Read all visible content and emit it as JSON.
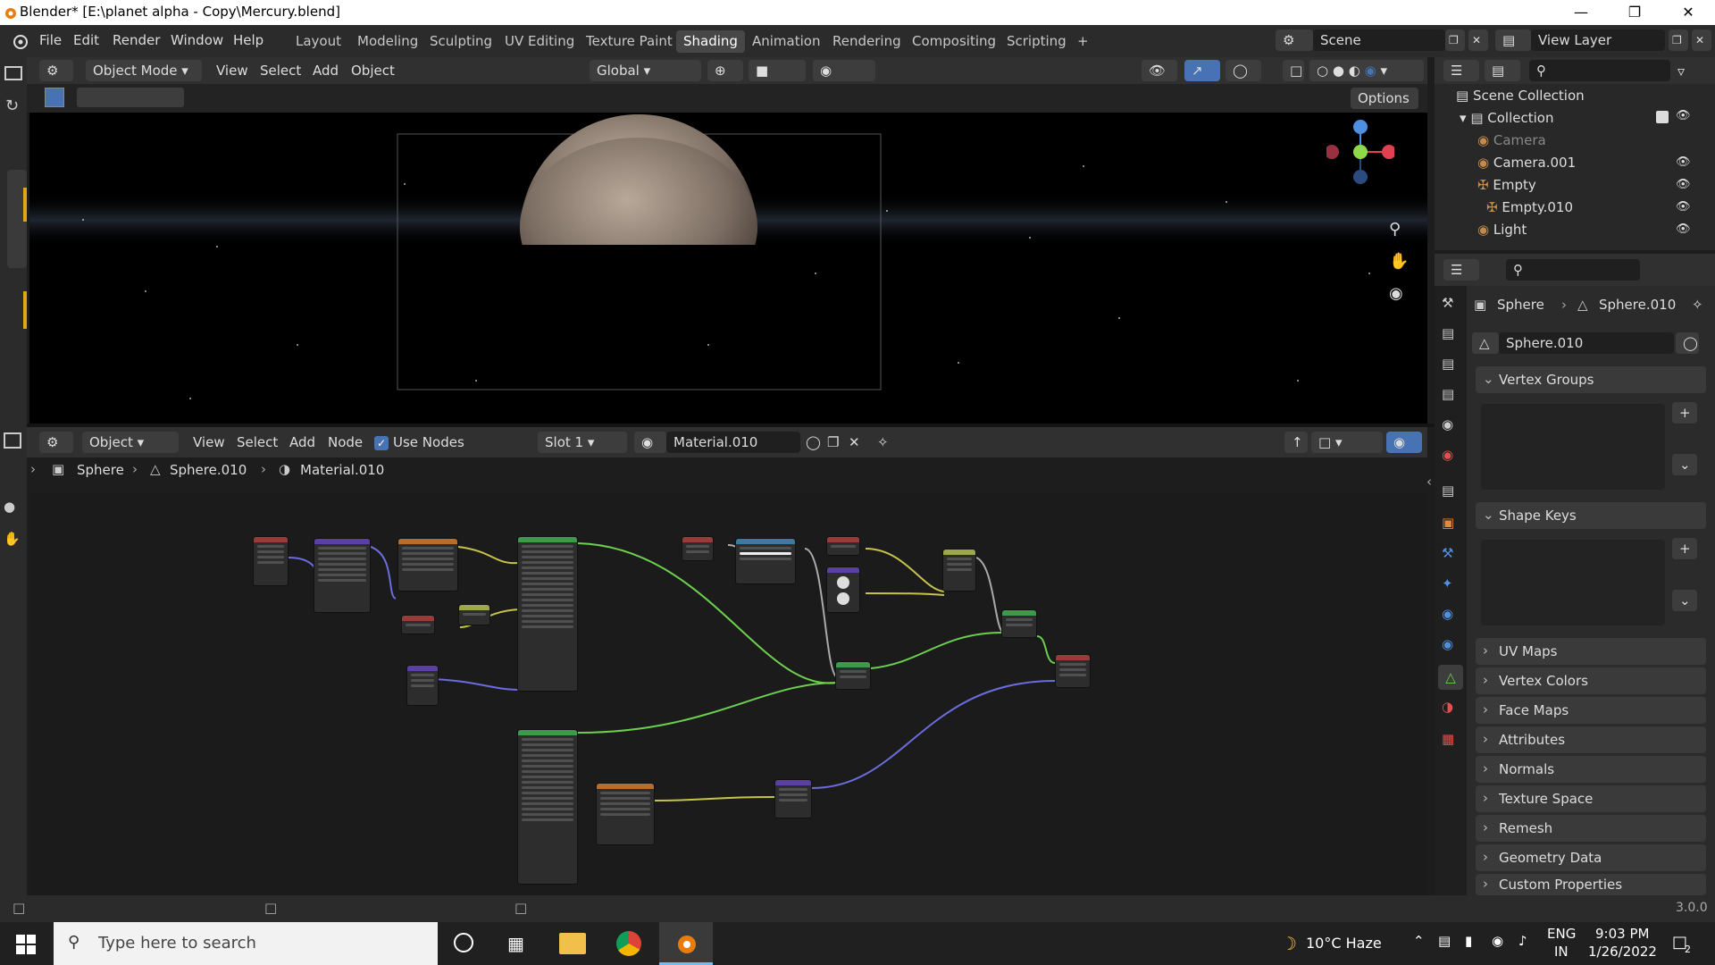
{
  "titlebar": {
    "title": "Blender* [E:\\planet alpha - Copy\\Mercury.blend]"
  },
  "menu": {
    "file": "File",
    "edit": "Edit",
    "render": "Render",
    "window": "Window",
    "help": "Help"
  },
  "workspaces": [
    "Layout",
    "Modeling",
    "Sculpting",
    "UV Editing",
    "Texture Paint",
    "Shading",
    "Animation",
    "Rendering",
    "Compositing",
    "Scripting"
  ],
  "active_workspace": "Shading",
  "scene": {
    "label": "Scene",
    "view_layer": "View Layer"
  },
  "viewport_header": {
    "mode": "Object Mode",
    "view": "View",
    "select": "Select",
    "add": "Add",
    "object": "Object",
    "transform": "Global",
    "options": "Options"
  },
  "node_header": {
    "type": "Object",
    "view": "View",
    "select": "Select",
    "add": "Add",
    "node": "Node",
    "use_nodes": "Use Nodes",
    "slot": "Slot 1",
    "material": "Material.010"
  },
  "breadcrumb": {
    "object": "Sphere",
    "mesh": "Sphere.010",
    "material": "Material.010"
  },
  "outliner": {
    "scene_collection": "Scene Collection",
    "collection": "Collection",
    "items": [
      "Camera",
      "Camera.001",
      "Empty",
      "Empty.010",
      "Light"
    ]
  },
  "properties": {
    "object": "Sphere",
    "mesh": "Sphere.010",
    "mesh_field": "Sphere.010",
    "panels": [
      "Vertex Groups",
      "Shape Keys",
      "UV Maps",
      "Vertex Colors",
      "Face Maps",
      "Attributes",
      "Normals",
      "Texture Space",
      "Remesh",
      "Geometry Data",
      "Custom Properties"
    ]
  },
  "status": {
    "version": "3.0.0"
  },
  "taskbar": {
    "search_placeholder": "Type here to search",
    "weather": "10°C Haze",
    "lang1": "ENG",
    "lang2": "IN",
    "time": "9:03 PM",
    "date": "1/26/2022",
    "notif": "2"
  },
  "colors": {
    "accent": "#4772b3",
    "green_link": "#6ccf4e",
    "yellow_link": "#c7c24a",
    "purple_link": "#6c6ce0"
  }
}
